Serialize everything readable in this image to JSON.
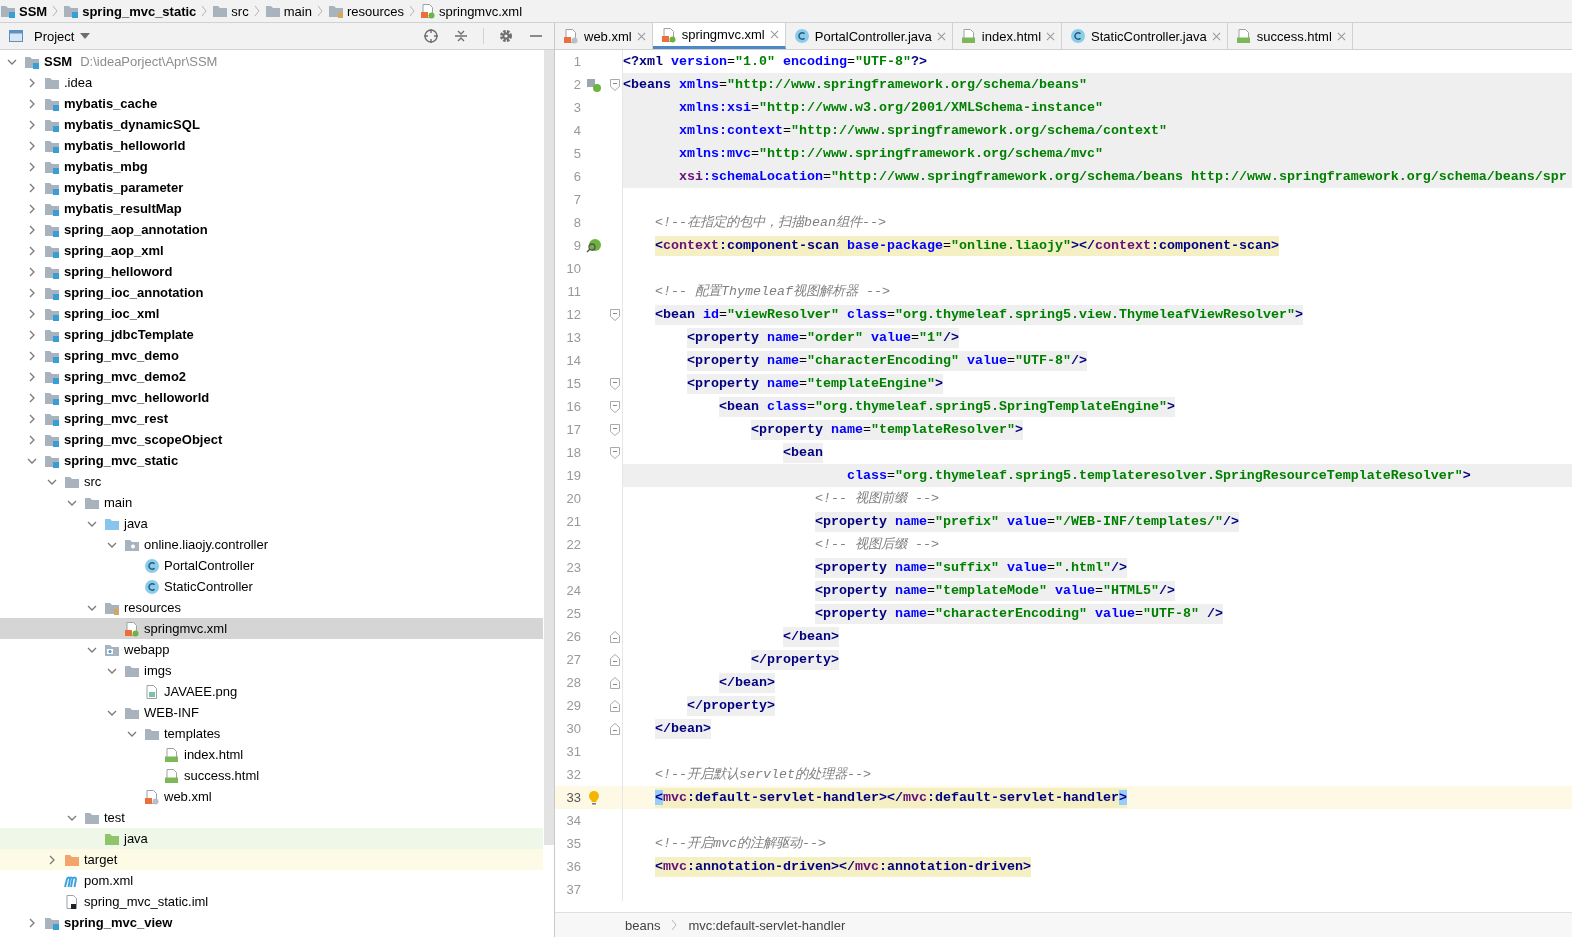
{
  "breadcrumb": [
    {
      "label": "SSM",
      "kind": "module"
    },
    {
      "label": "spring_mvc_static",
      "kind": "module"
    },
    {
      "label": "src",
      "kind": "folder"
    },
    {
      "label": "main",
      "kind": "folder"
    },
    {
      "label": "resources",
      "kind": "res-folder"
    },
    {
      "label": "springmvc.xml",
      "kind": "spring-xml"
    }
  ],
  "project_panel": {
    "title": "Project"
  },
  "tabs": [
    {
      "label": "web.xml",
      "kind": "webxml",
      "selected": false
    },
    {
      "label": "springmvc.xml",
      "kind": "spring-xml",
      "selected": true
    },
    {
      "label": "PortalController.java",
      "kind": "class",
      "selected": false
    },
    {
      "label": "index.html",
      "kind": "html",
      "selected": false
    },
    {
      "label": "StaticController.java",
      "kind": "class",
      "selected": false
    },
    {
      "label": "success.html",
      "kind": "html",
      "selected": false
    }
  ],
  "tree": {
    "label": "SSM",
    "path": "D:\\ideaPorject\\Apr\\SSM",
    "kind": "module",
    "expanded": true,
    "selected": false,
    "children": [
      {
        "label": ".idea",
        "kind": "folder",
        "expanded": false,
        "selected": false
      },
      {
        "label": "mybatis_cache",
        "kind": "module",
        "expanded": false,
        "selected": false
      },
      {
        "label": "mybatis_dynamicSQL",
        "kind": "module",
        "expanded": false,
        "selected": false
      },
      {
        "label": "mybatis_helloworld",
        "kind": "module",
        "expanded": false,
        "selected": false
      },
      {
        "label": "mybatis_mbg",
        "kind": "module",
        "expanded": false,
        "selected": false
      },
      {
        "label": "mybatis_parameter",
        "kind": "module",
        "expanded": false,
        "selected": false
      },
      {
        "label": "mybatis_resultMap",
        "kind": "module",
        "expanded": false,
        "selected": false
      },
      {
        "label": "spring_aop_annotation",
        "kind": "module",
        "expanded": false,
        "selected": false
      },
      {
        "label": "spring_aop_xml",
        "kind": "module",
        "expanded": false,
        "selected": false
      },
      {
        "label": "spring_helloword",
        "kind": "module",
        "expanded": false,
        "selected": false
      },
      {
        "label": "spring_ioc_annotation",
        "kind": "module",
        "expanded": false,
        "selected": false
      },
      {
        "label": "spring_ioc_xml",
        "kind": "module",
        "expanded": false,
        "selected": false
      },
      {
        "label": "spring_jdbcTemplate",
        "kind": "module",
        "expanded": false,
        "selected": false
      },
      {
        "label": "spring_mvc_demo",
        "kind": "module",
        "expanded": false,
        "selected": false
      },
      {
        "label": "spring_mvc_demo2",
        "kind": "module",
        "expanded": false,
        "selected": false
      },
      {
        "label": "spring_mvc_helloworld",
        "kind": "module",
        "expanded": false,
        "selected": false
      },
      {
        "label": "spring_mvc_rest",
        "kind": "module",
        "expanded": false,
        "selected": false
      },
      {
        "label": "spring_mvc_scopeObject",
        "kind": "module",
        "expanded": false,
        "selected": false
      },
      {
        "label": "spring_mvc_static",
        "kind": "module",
        "expanded": true,
        "selected": false,
        "children": [
          {
            "label": "src",
            "kind": "folder",
            "expanded": true,
            "selected": false,
            "children": [
              {
                "label": "main",
                "kind": "folder",
                "expanded": true,
                "selected": false,
                "children": [
                  {
                    "label": "java",
                    "kind": "src-folder",
                    "expanded": true,
                    "selected": false,
                    "children": [
                      {
                        "label": "online.liaojy.controller",
                        "kind": "package",
                        "expanded": true,
                        "selected": false,
                        "children": [
                          {
                            "label": "PortalController",
                            "kind": "class",
                            "selected": false
                          },
                          {
                            "label": "StaticController",
                            "kind": "class",
                            "selected": false
                          }
                        ]
                      }
                    ]
                  },
                  {
                    "label": "resources",
                    "kind": "res-folder",
                    "expanded": true,
                    "selected": false,
                    "children": [
                      {
                        "label": "springmvc.xml",
                        "kind": "spring-xml",
                        "selected": true
                      }
                    ]
                  },
                  {
                    "label": "webapp",
                    "kind": "webapp",
                    "expanded": true,
                    "selected": false,
                    "children": [
                      {
                        "label": "imgs",
                        "kind": "folder",
                        "expanded": true,
                        "selected": false,
                        "children": [
                          {
                            "label": "JAVAEE.png",
                            "kind": "image",
                            "selected": false
                          }
                        ]
                      },
                      {
                        "label": "WEB-INF",
                        "kind": "folder",
                        "expanded": true,
                        "selected": false,
                        "children": [
                          {
                            "label": "templates",
                            "kind": "folder",
                            "expanded": true,
                            "selected": false,
                            "children": [
                              {
                                "label": "index.html",
                                "kind": "html",
                                "selected": false
                              },
                              {
                                "label": "success.html",
                                "kind": "html",
                                "selected": false
                              }
                            ]
                          },
                          {
                            "label": "web.xml",
                            "kind": "webxml",
                            "selected": false
                          }
                        ]
                      }
                    ]
                  }
                ]
              },
              {
                "label": "test",
                "kind": "folder",
                "expanded": true,
                "selected": false,
                "children": [
                  {
                    "label": "java",
                    "kind": "test-folder",
                    "selected": false,
                    "color": "#eff7e8"
                  }
                ]
              }
            ]
          },
          {
            "label": "target",
            "kind": "excluded-folder",
            "expanded": false,
            "selected": false,
            "color": "#fdfbe6"
          },
          {
            "label": "pom.xml",
            "kind": "maven",
            "selected": false
          },
          {
            "label": "spring_mvc_static.iml",
            "kind": "iml",
            "selected": false
          }
        ]
      },
      {
        "label": "spring_mvc_view",
        "kind": "module",
        "expanded": false,
        "selected": false
      }
    ]
  },
  "editor": {
    "lines": [
      {
        "number": "1",
        "kind": "plain",
        "tokens": [
          {
            "kind": "t",
            "text": "<?xml"
          },
          {
            "kind": "a",
            "text": " version"
          },
          {
            "kind": "p",
            "text": "="
          },
          {
            "kind": "v",
            "text": "\"1.0\""
          },
          {
            "kind": "a",
            "text": " encoding"
          },
          {
            "kind": "p",
            "text": "="
          },
          {
            "kind": "v",
            "text": "\"UTF-8\""
          },
          {
            "kind": "t",
            "text": "?>"
          }
        ]
      },
      {
        "number": "2",
        "kind": "block",
        "gutter": [
          {
            "kind": "bean"
          },
          {
            "kind": "fold-open"
          }
        ],
        "tokens": [
          {
            "kind": "t",
            "text": "<beans"
          },
          {
            "kind": "a",
            "text": " xmlns"
          },
          {
            "kind": "p",
            "text": "="
          },
          {
            "kind": "v",
            "text": "\"http://www.springframework.org/schema/beans\""
          }
        ]
      },
      {
        "number": "3",
        "kind": "block",
        "tokens": [
          {
            "kind": "a",
            "text": "       xmlns:xsi"
          },
          {
            "kind": "p",
            "text": "="
          },
          {
            "kind": "v",
            "text": "\"http://www.w3.org/2001/XMLSchema-instance\""
          }
        ]
      },
      {
        "number": "4",
        "kind": "block",
        "tokens": [
          {
            "kind": "a",
            "text": "       xmlns:context"
          },
          {
            "kind": "p",
            "text": "="
          },
          {
            "kind": "v",
            "text": "\"http://www.springframework.org/schema/context\""
          }
        ]
      },
      {
        "number": "5",
        "kind": "block",
        "tokens": [
          {
            "kind": "a",
            "text": "       xmlns:mvc"
          },
          {
            "kind": "p",
            "text": "="
          },
          {
            "kind": "v",
            "text": "\"http://www.springframework.org/schema/mvc\""
          }
        ]
      },
      {
        "number": "6",
        "kind": "block",
        "tokens": [
          {
            "kind": "n",
            "text": "       xsi"
          },
          {
            "kind": "a",
            "text": ":schemaLocation"
          },
          {
            "kind": "p",
            "text": "="
          },
          {
            "kind": "v",
            "text": "\"http://www.springframework.org/schema/beans http://www.springframework.org/schema/beans/spr"
          }
        ]
      },
      {
        "number": "7",
        "kind": "plain"
      },
      {
        "number": "8",
        "kind": "plain",
        "tokens": [
          {
            "kind": "c",
            "text": "    <!--在指定的包中，扫描bean组件-->"
          }
        ]
      },
      {
        "number": "9",
        "kind": "match",
        "gutter": [
          {
            "kind": "scan"
          }
        ],
        "tokens": [
          {
            "kind": "t",
            "text": "    <"
          },
          {
            "kind": "n",
            "text": "context"
          },
          {
            "kind": "t",
            "text": ":component-scan"
          },
          {
            "kind": "a",
            "text": " base-package"
          },
          {
            "kind": "p",
            "text": "="
          },
          {
            "kind": "v",
            "text": "\"online.liaojy\""
          },
          {
            "kind": "t",
            "text": "></"
          },
          {
            "kind": "n",
            "text": "context"
          },
          {
            "kind": "t",
            "text": ":component-scan>"
          }
        ]
      },
      {
        "number": "10",
        "kind": "plain"
      },
      {
        "number": "11",
        "kind": "plain",
        "tokens": [
          {
            "kind": "c",
            "text": "    <!-- 配置Thymeleaf视图解析器 -->"
          }
        ]
      },
      {
        "number": "12",
        "kind": "tag",
        "gutter": [
          {
            "kind": "fold-open"
          }
        ],
        "tokens": [
          {
            "kind": "t",
            "text": "    <bean"
          },
          {
            "kind": "a",
            "text": " id"
          },
          {
            "kind": "p",
            "text": "="
          },
          {
            "kind": "v",
            "text": "\"viewResolver\""
          },
          {
            "kind": "a",
            "text": " class"
          },
          {
            "kind": "p",
            "text": "="
          },
          {
            "kind": "v",
            "text": "\"org.thymeleaf.spring5.view.ThymeleafViewResolver\""
          },
          {
            "kind": "t",
            "text": ">"
          }
        ]
      },
      {
        "number": "13",
        "kind": "tag",
        "tokens": [
          {
            "kind": "t",
            "text": "        <property"
          },
          {
            "kind": "a",
            "text": " name"
          },
          {
            "kind": "p",
            "text": "="
          },
          {
            "kind": "v",
            "text": "\"order\""
          },
          {
            "kind": "a",
            "text": " value"
          },
          {
            "kind": "p",
            "text": "="
          },
          {
            "kind": "v",
            "text": "\"1\""
          },
          {
            "kind": "t",
            "text": "/>"
          }
        ]
      },
      {
        "number": "14",
        "kind": "tag",
        "tokens": [
          {
            "kind": "t",
            "text": "        <property"
          },
          {
            "kind": "a",
            "text": " name"
          },
          {
            "kind": "p",
            "text": "="
          },
          {
            "kind": "v",
            "text": "\"characterEncoding\""
          },
          {
            "kind": "a",
            "text": " value"
          },
          {
            "kind": "p",
            "text": "="
          },
          {
            "kind": "v",
            "text": "\"UTF-8\""
          },
          {
            "kind": "t",
            "text": "/>"
          }
        ]
      },
      {
        "number": "15",
        "kind": "tag",
        "gutter": [
          {
            "kind": "fold-open"
          }
        ],
        "tokens": [
          {
            "kind": "t",
            "text": "        <property"
          },
          {
            "kind": "a",
            "text": " name"
          },
          {
            "kind": "p",
            "text": "="
          },
          {
            "kind": "v",
            "text": "\"templateEngine\""
          },
          {
            "kind": "t",
            "text": ">"
          }
        ]
      },
      {
        "number": "16",
        "kind": "tag",
        "gutter": [
          {
            "kind": "fold-open"
          }
        ],
        "tokens": [
          {
            "kind": "t",
            "text": "            <bean"
          },
          {
            "kind": "a",
            "text": " class"
          },
          {
            "kind": "p",
            "text": "="
          },
          {
            "kind": "v",
            "text": "\"org.thymeleaf.spring5.SpringTemplateEngine\""
          },
          {
            "kind": "t",
            "text": ">"
          }
        ]
      },
      {
        "number": "17",
        "kind": "tag",
        "gutter": [
          {
            "kind": "fold-open"
          }
        ],
        "tokens": [
          {
            "kind": "t",
            "text": "                <property"
          },
          {
            "kind": "a",
            "text": " name"
          },
          {
            "kind": "p",
            "text": "="
          },
          {
            "kind": "v",
            "text": "\"templateResolver\""
          },
          {
            "kind": "t",
            "text": ">"
          }
        ]
      },
      {
        "number": "18",
        "kind": "tag",
        "gutter": [
          {
            "kind": "fold-open"
          }
        ],
        "tokens": [
          {
            "kind": "t",
            "text": "                    <bean"
          }
        ]
      },
      {
        "number": "19",
        "kind": "block",
        "tokens": [
          {
            "kind": "a",
            "text": "                            class"
          },
          {
            "kind": "p",
            "text": "="
          },
          {
            "kind": "v",
            "text": "\"org.thymeleaf.spring5.templateresolver.SpringResourceTemplateResolver\""
          },
          {
            "kind": "t",
            "text": ">"
          }
        ]
      },
      {
        "number": "20",
        "kind": "plain",
        "tokens": [
          {
            "kind": "c",
            "text": "                        <!-- 视图前缀 -->"
          }
        ]
      },
      {
        "number": "21",
        "kind": "tag",
        "tokens": [
          {
            "kind": "t",
            "text": "                        <property"
          },
          {
            "kind": "a",
            "text": " name"
          },
          {
            "kind": "p",
            "text": "="
          },
          {
            "kind": "v",
            "text": "\"prefix\""
          },
          {
            "kind": "a",
            "text": " value"
          },
          {
            "kind": "p",
            "text": "="
          },
          {
            "kind": "v",
            "text": "\"/WEB-INF/templates/\""
          },
          {
            "kind": "t",
            "text": "/>"
          }
        ]
      },
      {
        "number": "22",
        "kind": "plain",
        "tokens": [
          {
            "kind": "c",
            "text": "                        <!-- 视图后缀 -->"
          }
        ]
      },
      {
        "number": "23",
        "kind": "tag",
        "tokens": [
          {
            "kind": "t",
            "text": "                        <property"
          },
          {
            "kind": "a",
            "text": " name"
          },
          {
            "kind": "p",
            "text": "="
          },
          {
            "kind": "v",
            "text": "\"suffix\""
          },
          {
            "kind": "a",
            "text": " value"
          },
          {
            "kind": "p",
            "text": "="
          },
          {
            "kind": "v",
            "text": "\".html\""
          },
          {
            "kind": "t",
            "text": "/>"
          }
        ]
      },
      {
        "number": "24",
        "kind": "tag",
        "tokens": [
          {
            "kind": "t",
            "text": "                        <property"
          },
          {
            "kind": "a",
            "text": " name"
          },
          {
            "kind": "p",
            "text": "="
          },
          {
            "kind": "v",
            "text": "\"templateMode\""
          },
          {
            "kind": "a",
            "text": " value"
          },
          {
            "kind": "p",
            "text": "="
          },
          {
            "kind": "v",
            "text": "\"HTML5\""
          },
          {
            "kind": "t",
            "text": "/>"
          }
        ]
      },
      {
        "number": "25",
        "kind": "tag",
        "tokens": [
          {
            "kind": "t",
            "text": "                        <property"
          },
          {
            "kind": "a",
            "text": " name"
          },
          {
            "kind": "p",
            "text": "="
          },
          {
            "kind": "v",
            "text": "\"characterEncoding\""
          },
          {
            "kind": "a",
            "text": " value"
          },
          {
            "kind": "p",
            "text": "="
          },
          {
            "kind": "v",
            "text": "\"UTF-8\""
          },
          {
            "kind": "t",
            "text": " />"
          }
        ]
      },
      {
        "number": "26",
        "kind": "tag",
        "gutter": [
          {
            "kind": "fold-close"
          }
        ],
        "tokens": [
          {
            "kind": "t",
            "text": "                    </bean>"
          }
        ]
      },
      {
        "number": "27",
        "kind": "tag",
        "gutter": [
          {
            "kind": "fold-close"
          }
        ],
        "tokens": [
          {
            "kind": "t",
            "text": "                </property>"
          }
        ]
      },
      {
        "number": "28",
        "kind": "tag",
        "gutter": [
          {
            "kind": "fold-close"
          }
        ],
        "tokens": [
          {
            "kind": "t",
            "text": "            </bean>"
          }
        ]
      },
      {
        "number": "29",
        "kind": "tag",
        "gutter": [
          {
            "kind": "fold-close"
          }
        ],
        "tokens": [
          {
            "kind": "t",
            "text": "        </property>"
          }
        ]
      },
      {
        "number": "30",
        "kind": "tag",
        "gutter": [
          {
            "kind": "fold-close"
          }
        ],
        "tokens": [
          {
            "kind": "t",
            "text": "    </bean>"
          }
        ]
      },
      {
        "number": "31",
        "kind": "plain"
      },
      {
        "number": "32",
        "kind": "plain",
        "tokens": [
          {
            "kind": "c",
            "text": "    <!--开启默认servlet的处理器-->"
          }
        ]
      },
      {
        "number": "33",
        "kind": "current",
        "gutter": [
          {
            "kind": "bulb"
          }
        ],
        "tokens": [
          {
            "kind": "b",
            "text": "    <"
          },
          {
            "kind": "n",
            "text": "mvc"
          },
          {
            "kind": "t",
            "text": ":default-servlet-handler></"
          },
          {
            "kind": "n",
            "text": "mvc"
          },
          {
            "kind": "t",
            "text": ":default-servlet-handler"
          },
          {
            "kind": "b",
            "text": ">"
          }
        ]
      },
      {
        "number": "34",
        "kind": "plain"
      },
      {
        "number": "35",
        "kind": "plain",
        "tokens": [
          {
            "kind": "c",
            "text": "    <!--开启mvc的注解驱动-->"
          }
        ]
      },
      {
        "number": "36",
        "kind": "match",
        "tokens": [
          {
            "kind": "t",
            "text": "    <"
          },
          {
            "kind": "n",
            "text": "mvc"
          },
          {
            "kind": "t",
            "text": ":annotation-driven></"
          },
          {
            "kind": "n",
            "text": "mvc"
          },
          {
            "kind": "t",
            "text": ":annotation-driven>"
          }
        ]
      },
      {
        "number": "37",
        "kind": "plain"
      }
    ]
  },
  "status_breadcrumb": [
    "beans",
    "mvc:default-servlet-handler"
  ]
}
